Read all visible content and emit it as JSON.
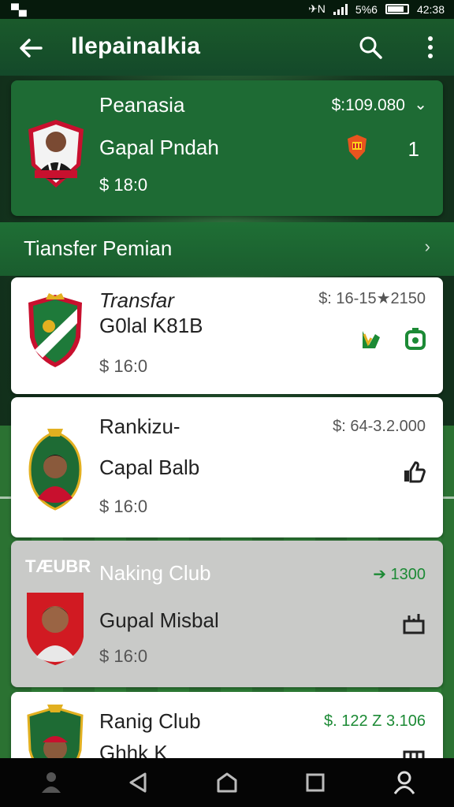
{
  "status_bar": {
    "left_icon": "notification-icon",
    "sig_text": "5%6",
    "time": "42:38"
  },
  "app_bar": {
    "title": "Ilepainalkia",
    "back_icon": "arrow-left-icon",
    "search_icon": "search-icon",
    "more_icon": "more-vertical-icon"
  },
  "hero": {
    "name": "Peanasia",
    "value": "$:109.080",
    "sub": "Gapal Pndah",
    "price": "$ 18:0",
    "count": "1",
    "colors": {
      "bg": "#1e6b34"
    }
  },
  "section": {
    "label": "Tiansfer Pemian"
  },
  "items": [
    {
      "line1": "Transfar",
      "line2": "G0lal K81B",
      "price": "$ 16:0",
      "value": "$: 16-15★2150"
    },
    {
      "line1": "Rankizu-",
      "line2": "Capal Balb",
      "price": "$ 16:0",
      "value": "$: 64-3.2.000"
    },
    {
      "tag": "TÆUBR",
      "line1": "Naking Club",
      "line2": "Gupal Misbal",
      "price": "$ 16:0",
      "value": "➔ 1300"
    },
    {
      "line1": "Ranig Club",
      "line2": "Ghhk K",
      "value": "$. 122 Z 3.106"
    }
  ],
  "accent_green": "#1c8a35"
}
